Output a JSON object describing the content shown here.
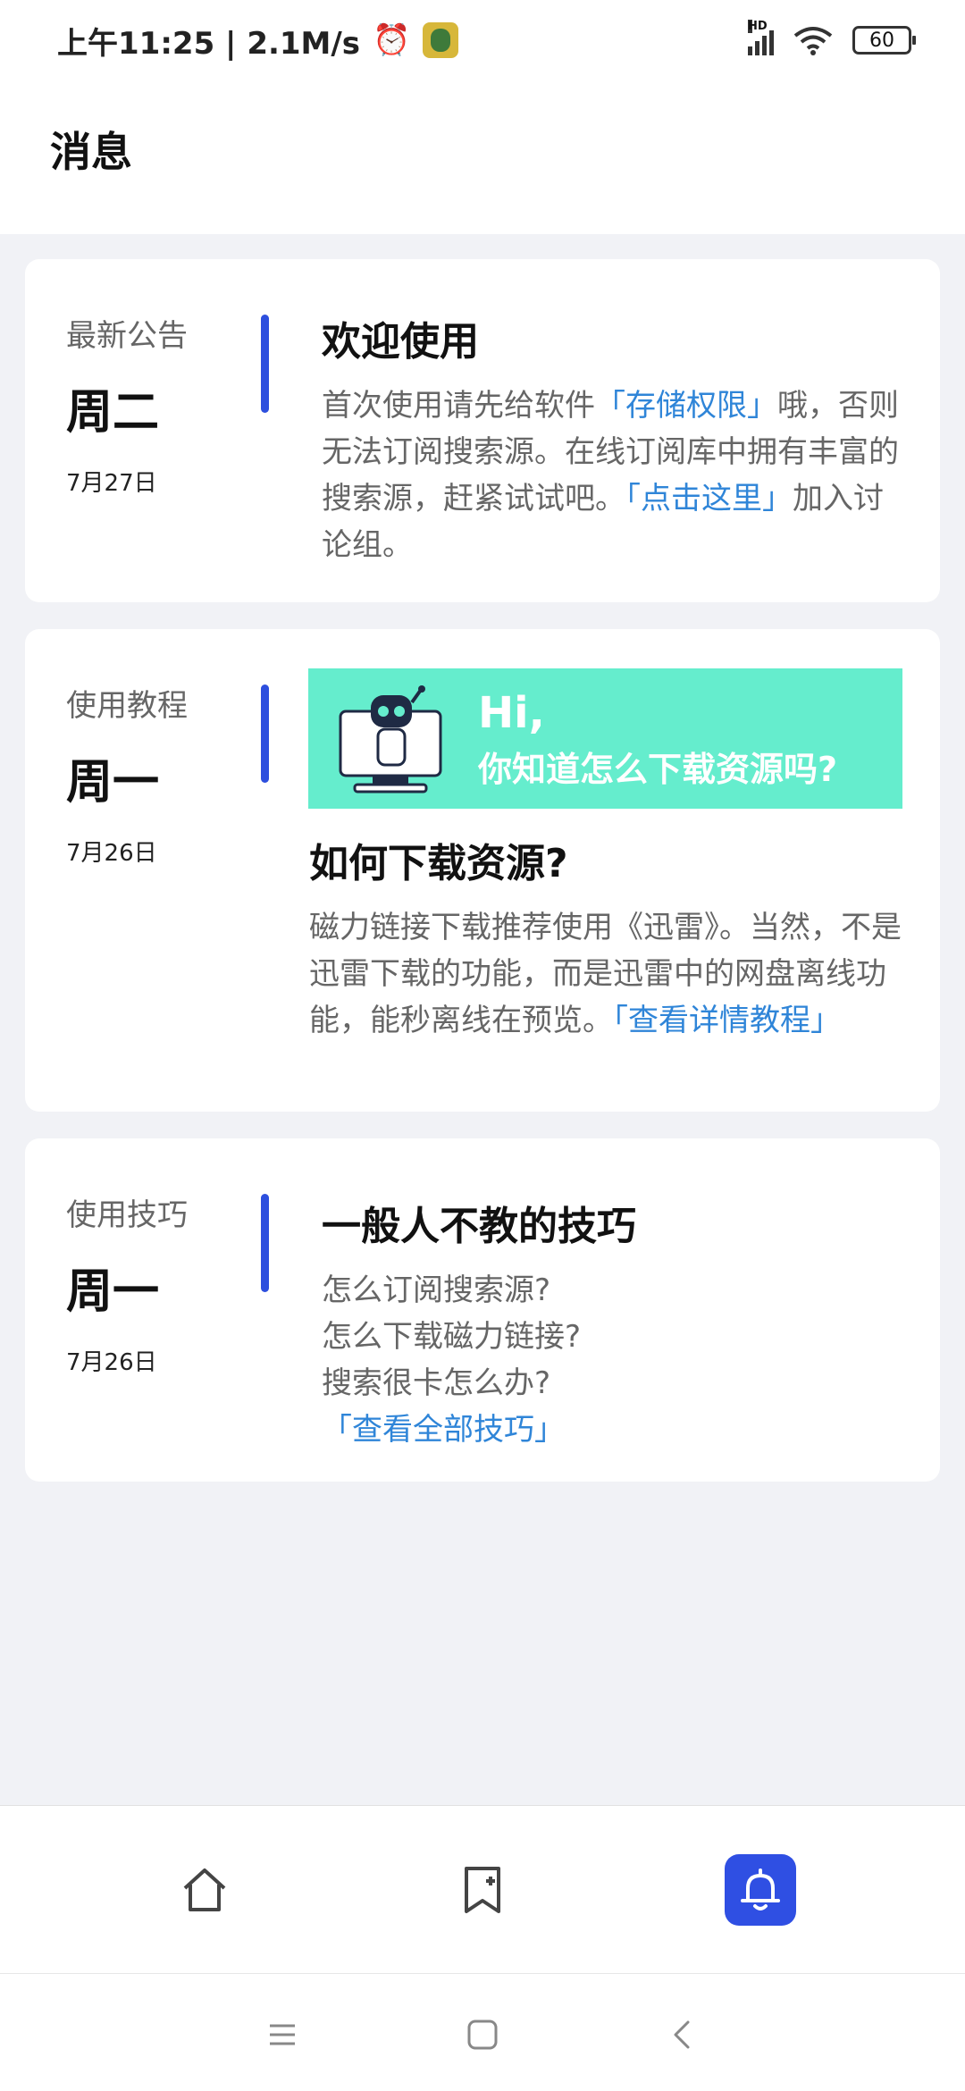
{
  "status_bar": {
    "time_speed": "上午11:25 | 2.1M/s",
    "alarm_icon": "alarm-clock-icon",
    "signal_label": "HD",
    "battery": "60"
  },
  "header": {
    "title": "消息"
  },
  "cards": [
    {
      "category": "最新公告",
      "weekday": "周二",
      "date": "7月27日",
      "heading": "欢迎使用",
      "segments": [
        "首次使用请先给软件",
        "「存储权限」",
        "哦，否则无法订阅搜索源。在线订阅库中拥有丰富的搜索源，赶紧试试吧。",
        "「点击这里」",
        "加入讨论组。"
      ]
    },
    {
      "category": "使用教程",
      "weekday": "周一",
      "date": "7月26日",
      "banner": {
        "line1": "Hi,",
        "line2": "你知道怎么下载资源吗?"
      },
      "heading": "如何下载资源?",
      "segments": [
        "磁力链接下载推荐使用《迅雷》。当然，不是迅雷下载的功能，而是迅雷中的网盘离线功能，能秒离线在预览。",
        "「查看详情教程」"
      ]
    },
    {
      "category": "使用技巧",
      "weekday": "周一",
      "date": "7月26日",
      "heading": "一般人不教的技巧",
      "lines": [
        "怎么订阅搜索源?",
        "怎么下载磁力链接?",
        "搜索很卡怎么办?"
      ],
      "link": "「查看全部技巧」"
    }
  ],
  "bottom_nav": [
    {
      "icon": "home-icon",
      "active": false
    },
    {
      "icon": "bookmark-add-icon",
      "active": false
    },
    {
      "icon": "bell-icon",
      "active": true
    }
  ],
  "system_nav": [
    "menu-icon",
    "home-square-icon",
    "back-icon"
  ],
  "colors": {
    "accent": "#2d4fde",
    "link": "#2f85d8",
    "banner": "#65edcd"
  }
}
